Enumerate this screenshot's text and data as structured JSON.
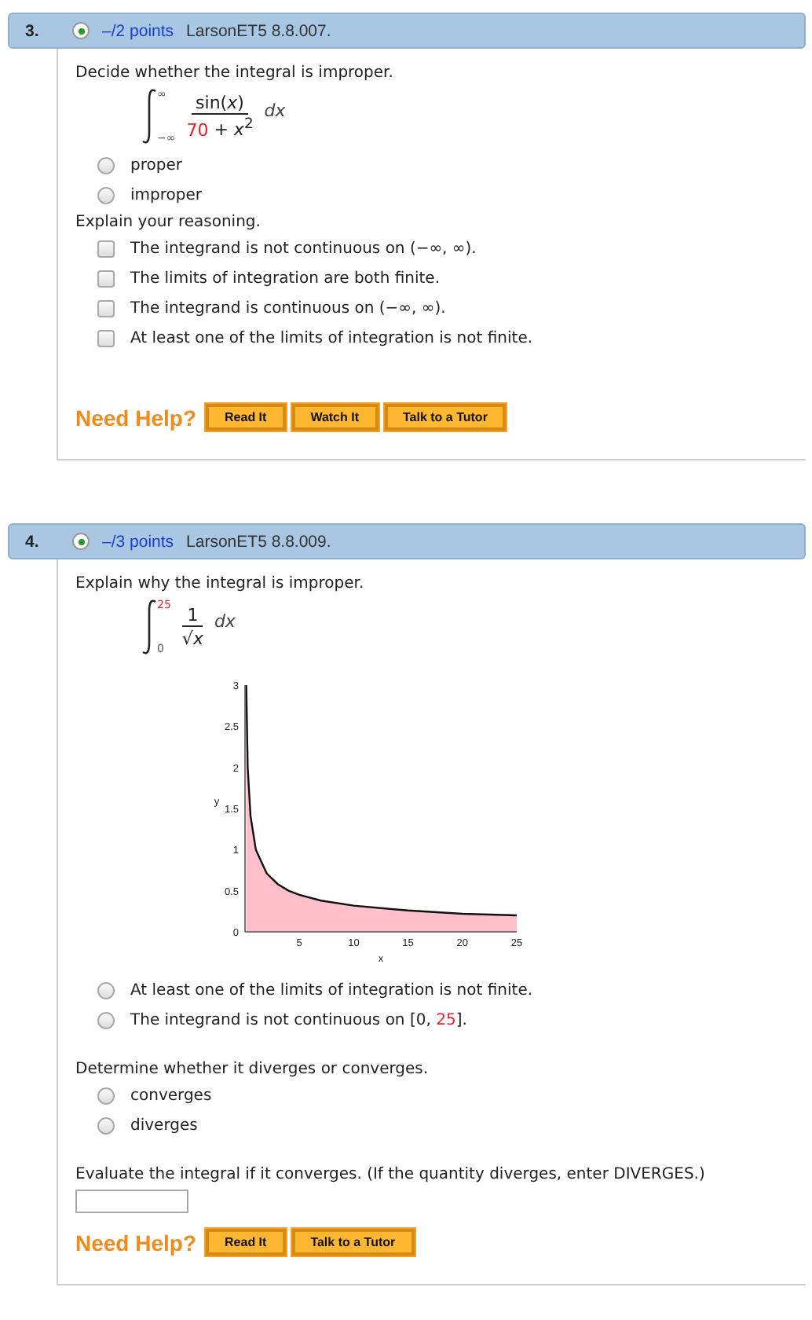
{
  "questions": [
    {
      "number": "3.",
      "points": "–/2 points",
      "source": "LarsonET5 8.8.007.",
      "parts": [
        {
          "kind": "prompt",
          "text": "Decide whether the integral is improper."
        },
        {
          "kind": "integral",
          "upper": [
            {
              "text": "∞",
              "highlight": false
            }
          ],
          "lower": [
            {
              "text": "−∞",
              "highlight": false
            }
          ],
          "numerator": [
            {
              "text": "sin(*x*)",
              "highlight": false
            }
          ],
          "denominator": [
            {
              "text": "70",
              "highlight": true
            },
            {
              "text": " + *x*$^{2}$",
              "highlight": false
            }
          ],
          "differential": "*dx*"
        },
        {
          "kind": "radio",
          "options": [
            {
              "text": [
                {
                  "text": "proper",
                  "highlight": false
                }
              ],
              "selected": false
            },
            {
              "text": [
                {
                  "text": "improper",
                  "highlight": false
                }
              ],
              "selected": false
            }
          ]
        },
        {
          "kind": "prompt",
          "text": "Explain your reasoning."
        },
        {
          "kind": "checkbox",
          "options": [
            {
              "text": "The integrand is not continuous on (−∞, ∞).",
              "checked": false
            },
            {
              "text": "The limits of integration are both finite.",
              "checked": false
            },
            {
              "text": "The integrand is continuous on (−∞, ∞).",
              "checked": false
            },
            {
              "text": "At least one of the limits of integration is not finite.",
              "checked": false
            }
          ]
        },
        {
          "kind": "help",
          "label": "Need Help?",
          "buttons": [
            "Read It",
            "Watch It",
            "Talk to a Tutor"
          ]
        }
      ]
    },
    {
      "number": "4.",
      "points": "–/3 points",
      "source": "LarsonET5 8.8.009.",
      "parts": [
        {
          "kind": "prompt",
          "text": "Explain why the integral is improper."
        },
        {
          "kind": "integral",
          "upper": [
            {
              "text": "25",
              "highlight": true
            }
          ],
          "lower": [
            {
              "text": "0",
              "highlight": false
            }
          ],
          "numerator": [
            {
              "text": "1",
              "highlight": false
            }
          ],
          "denominator": [
            {
              "text": "√*x*",
              "highlight": false
            }
          ],
          "differential": "*dx*"
        },
        {
          "kind": "chart",
          "chart_data": {
            "type": "area",
            "xlabel": "x",
            "ylabel": "y",
            "x": [
              0.111,
              0.25,
              0.5,
              1,
              2,
              3,
              4,
              5,
              7,
              10,
              15,
              20,
              25
            ],
            "series": [
              {
                "color": "#ffc0cb",
                "values": [
                  3.0,
                  2.0,
                  1.41,
                  1.0,
                  0.71,
                  0.58,
                  0.5,
                  0.45,
                  0.38,
                  0.32,
                  0.26,
                  0.22,
                  0.2
                ]
              }
            ],
            "xlim": [
              0,
              25
            ],
            "ylim": [
              0,
              3
            ],
            "xticks": [
              5,
              10,
              15,
              20,
              25
            ],
            "yticks": [
              0,
              0.5,
              1,
              1.5,
              2,
              2.5,
              3
            ]
          }
        },
        {
          "kind": "radio",
          "options": [
            {
              "text": [
                {
                  "text": "At least one of the limits of integration is not finite.",
                  "highlight": false
                }
              ],
              "selected": false
            },
            {
              "text": [
                {
                  "text": "The integrand is not continuous on [0, ",
                  "highlight": false
                },
                {
                  "text": "25",
                  "highlight": true
                },
                {
                  "text": "].",
                  "highlight": false
                }
              ],
              "selected": false
            }
          ]
        },
        {
          "kind": "prompt",
          "text": "Determine whether it diverges or converges."
        },
        {
          "kind": "radio",
          "options": [
            {
              "text": [
                {
                  "text": "converges",
                  "highlight": false
                }
              ],
              "selected": false
            },
            {
              "text": [
                {
                  "text": "diverges",
                  "highlight": false
                }
              ],
              "selected": false
            }
          ]
        },
        {
          "kind": "prompt",
          "text": "Evaluate the integral if it converges. (If the quantity diverges, enter DIVERGES.)"
        },
        {
          "kind": "field"
        },
        {
          "kind": "help",
          "label": "Need Help?",
          "buttons": [
            "Read It",
            "Talk to a Tutor"
          ]
        }
      ]
    }
  ]
}
